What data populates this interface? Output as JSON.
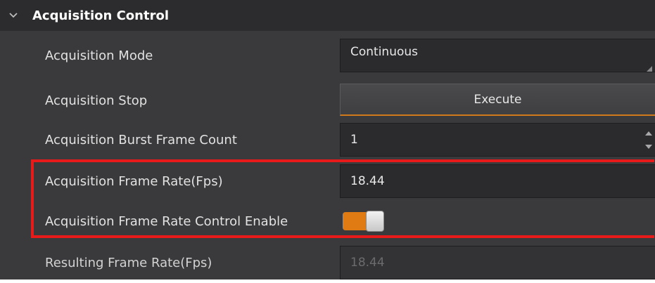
{
  "section": {
    "title": "Acquisition Control",
    "expand_icon": "chevron-down-icon"
  },
  "rows": {
    "acquisition_mode": {
      "label": "Acquisition Mode",
      "value": "Continuous"
    },
    "acquisition_stop": {
      "label": "Acquisition Stop",
      "button_label": "Execute"
    },
    "burst_frame_count": {
      "label": "Acquisition Burst Frame Count",
      "value": "1"
    },
    "frame_rate": {
      "label": "Acquisition Frame Rate(Fps)",
      "value": "18.44"
    },
    "frame_rate_enable": {
      "label": "Acquisition Frame Rate Control Enable",
      "enabled": true
    },
    "resulting_frame_rate": {
      "label": "Resulting Frame Rate(Fps)",
      "value": "18.44"
    }
  },
  "colors": {
    "panel_bg": "#3a3a3c",
    "field_bg": "#2b2b2d",
    "accent": "#e07a12",
    "highlight": "#e81a1a"
  }
}
